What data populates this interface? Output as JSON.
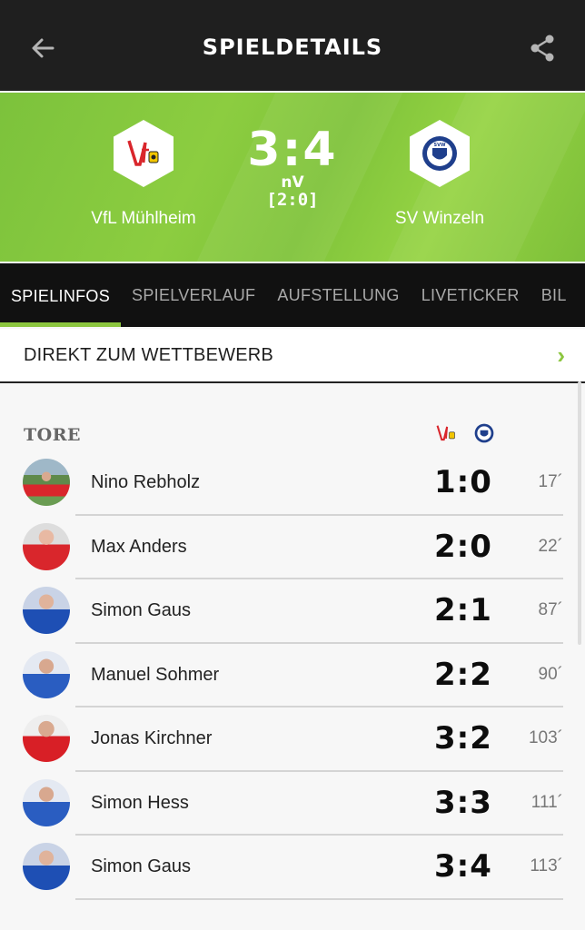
{
  "header": {
    "title": "SPIELDETAILS",
    "back_icon": "arrow-left-icon",
    "share_icon": "share-icon"
  },
  "match": {
    "home": {
      "name": "VfL Mühlheim",
      "logo": "vfl-muehlheim-crest"
    },
    "away": {
      "name": "SV Winzeln",
      "logo": "sv-winzeln-crest"
    },
    "score": "3:4",
    "extra": "nV",
    "halftime": "[2:0]"
  },
  "tabs": [
    {
      "label": "SPIELINFOS",
      "active": true
    },
    {
      "label": "SPIELVERLAUF",
      "active": false
    },
    {
      "label": "AUFSTELLUNG",
      "active": false
    },
    {
      "label": "LIVETICKER",
      "active": false
    },
    {
      "label": "BIL",
      "active": false
    }
  ],
  "competition_link": {
    "label": "DIREKT ZUM WETTBEWERB",
    "icon": "chevron-right-icon"
  },
  "goals": {
    "title": "TORE",
    "items": [
      {
        "player": "Nino Rebholz",
        "score": "1:0",
        "minute": "17´",
        "team": "home"
      },
      {
        "player": "Max Anders",
        "score": "2:0",
        "minute": "22´",
        "team": "home"
      },
      {
        "player": "Simon Gaus",
        "score": "2:1",
        "minute": "87´",
        "team": "away"
      },
      {
        "player": "Manuel Sohmer",
        "score": "2:2",
        "minute": "90´",
        "team": "away"
      },
      {
        "player": "Jonas Kirchner",
        "score": "3:2",
        "minute": "103´",
        "team": "home"
      },
      {
        "player": "Simon Hess",
        "score": "3:3",
        "minute": "111´",
        "team": "away"
      },
      {
        "player": "Simon Gaus",
        "score": "3:4",
        "minute": "113´",
        "team": "away"
      }
    ]
  },
  "colors": {
    "accent": "#8cc63f",
    "topbar": "#1f1f1f",
    "tabs_bg": "#111111"
  }
}
